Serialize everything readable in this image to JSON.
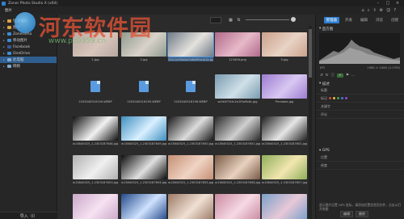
{
  "window": {
    "title": "Zoner Photo Studio X (x64)"
  },
  "toolbar": {
    "menu": "图片"
  },
  "watermark": {
    "brand": "河东软件园",
    "url": "www.pc0359.cn"
  },
  "sidebar": {
    "items": [
      {
        "label": "快速访问",
        "level": 0,
        "icon_color": "#d9a441"
      },
      {
        "label": "图片",
        "level": 0,
        "icon_color": "#d9a441"
      },
      {
        "label": "Zonerama",
        "level": 0,
        "icon_color": "#3b8fd8"
      },
      {
        "label": "移动图片",
        "level": 0,
        "icon_color": "#3b8fd8"
      },
      {
        "label": "Facebook",
        "level": 0,
        "icon_color": "#3b5998"
      },
      {
        "label": "OneDrive",
        "level": 0,
        "icon_color": "#3b8fd8"
      },
      {
        "label": "此电脑",
        "level": 0,
        "icon_color": "#7fa8d8",
        "active": true
      },
      {
        "label": "网络",
        "level": 0,
        "icon_color": "#7fa8d8"
      }
    ],
    "footer": "导入（I）"
  },
  "grid": {
    "items": [
      {
        "caption": "1.jpg",
        "kind": "photo",
        "colors": [
          "#b7a89f",
          "#d8c6bc"
        ]
      },
      {
        "caption": "2.jpg",
        "kind": "photo",
        "colors": [
          "#8e9a8e",
          "#d9d2c9"
        ]
      },
      {
        "caption": "2f4c1e3f5b6a7d8e9f0a1b2c.jpg",
        "kind": "photo",
        "colors": [
          "#6f7a86",
          "#e5e2de"
        ],
        "selected": true
      },
      {
        "caption": "123456.png",
        "kind": "photo",
        "colors": [
          "#b06a8a",
          "#e7b9c8"
        ]
      },
      {
        "caption": "5.jpg",
        "kind": "photo",
        "colors": [
          "#caa18a",
          "#e8d3c5"
        ]
      },
      {
        "caption": "2203040516194.WEBP",
        "kind": "doc"
      },
      {
        "caption": "2203040516195.WEBP",
        "kind": "doc"
      },
      {
        "caption": "2203040516196.WEBP",
        "kind": "doc"
      },
      {
        "caption": "sa5b5f7d3c2e1f0a9b8c.jpg",
        "kind": "photo",
        "colors": [
          "#7a9bb0",
          "#cfe0e8"
        ]
      },
      {
        "caption": "Printable.jpg",
        "kind": "photo",
        "colors": [
          "#9c7bd0",
          "#d9c8f2"
        ]
      },
      {
        "caption": "w13840325_1-2303187648.jpg",
        "kind": "photo",
        "colors": [
          "#101010",
          "#f2f2f2"
        ]
      },
      {
        "caption": "w13840325_1-2303187649.jpg",
        "kind": "photo",
        "colors": [
          "#3f8fbf",
          "#d9f0ff"
        ]
      },
      {
        "caption": "w13840325_1-2303187650.jpg",
        "kind": "photo",
        "colors": [
          "#1a1a1a",
          "#dcdcdc"
        ]
      },
      {
        "caption": "w13840325_1-2303187651.jpg",
        "kind": "photo",
        "colors": [
          "#2a2a2a",
          "#cfcfcf"
        ]
      },
      {
        "caption": "w13840325_1-2303187652.jpg",
        "kind": "photo",
        "colors": [
          "#202020",
          "#e6e6e6"
        ]
      },
      {
        "caption": "w13840325_1-2303187653.jpg",
        "kind": "photo",
        "colors": [
          "#b0b0b0",
          "#f0f0f0"
        ]
      },
      {
        "caption": "w13840325_1-2303187654.jpg",
        "kind": "photo",
        "colors": [
          "#0d0d0d",
          "#e0e0e0"
        ]
      },
      {
        "caption": "w13840325_1-2303187655.jpg",
        "kind": "photo",
        "colors": [
          "#c48f74",
          "#f0d4c4"
        ]
      },
      {
        "caption": "w13840325_1-2303187656.jpg",
        "kind": "photo",
        "colors": [
          "#7a5a46",
          "#e8d2bf"
        ]
      },
      {
        "caption": "w13840325_1-2303187657.jpg",
        "kind": "photo",
        "colors": [
          "#8fae5a",
          "#f2e6b0"
        ]
      },
      {
        "caption": "",
        "kind": "photo",
        "colors": [
          "#c9a8c8",
          "#f6e2f2"
        ]
      },
      {
        "caption": "",
        "kind": "photo",
        "colors": [
          "#244a8a",
          "#cfe2ff"
        ]
      },
      {
        "caption": "",
        "kind": "photo",
        "colors": [
          "#9c7a66",
          "#f0e0d4"
        ]
      },
      {
        "caption": "",
        "kind": "photo",
        "colors": [
          "#c98aa0",
          "#f6d9e4"
        ]
      },
      {
        "caption": "",
        "kind": "photo",
        "colors": [
          "#7aa0c8",
          "#e8c8d8"
        ]
      }
    ]
  },
  "right": {
    "tabs": [
      "管理器",
      "开发",
      "编辑",
      "浏览",
      "创建"
    ],
    "active_tab": "管理器",
    "histogram_title": "直方图",
    "hist_left": "JPG",
    "hist_right": "1960 × 1080 (2.07M)",
    "describe_title": "描述",
    "meta_rows": [
      "标题",
      "标记",
      "关键字",
      "评论"
    ],
    "gps_title": "GPS",
    "gps_rows": [
      "位置",
      "经度"
    ],
    "footer_text": "显示图片位置 GPS 坐标，请添加位置信息到文件，点击以打开地图",
    "buttons": [
      "编辑",
      "删除"
    ]
  }
}
